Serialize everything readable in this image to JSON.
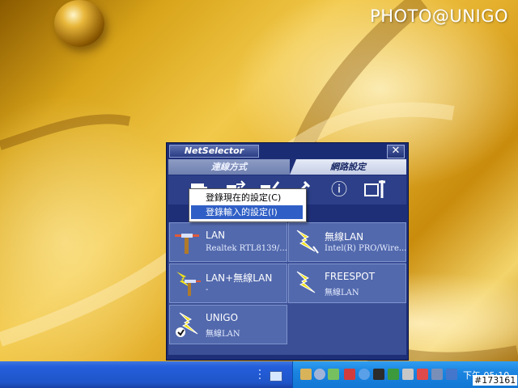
{
  "watermark": "PHOTO@UNIGO",
  "window": {
    "app_name": "NetSelector",
    "close_glyph": "✕",
    "tabs": [
      {
        "label": "連線方式",
        "active": false
      },
      {
        "label": "網路設定",
        "active": true
      }
    ],
    "toolbar_icons": [
      "register-icon",
      "transfer-icon",
      "edit-icon",
      "tools-icon",
      "info-icon",
      "settings-icon"
    ],
    "info_glyph": "ⓘ",
    "context_menu": [
      {
        "label": "登錄現在的設定(C)",
        "selected": false
      },
      {
        "label": "登錄輸入的設定(I)",
        "selected": true
      }
    ],
    "cards": [
      {
        "title": "LAN",
        "subtitle": "Realtek RTL8139/...",
        "icon": "lan-icon"
      },
      {
        "title": "無線LAN",
        "subtitle": "Intel(R) PRO/Wire...",
        "icon": "wireless-icon"
      },
      {
        "title": "LAN+無線LAN",
        "subtitle": "-",
        "icon": "lan-wireless-icon"
      },
      {
        "title": "FREESPOT",
        "subtitle": "無線LAN",
        "icon": "wireless-icon"
      },
      {
        "title": "UNIGO",
        "subtitle": "無線LAN",
        "icon": "wireless-checked-icon",
        "checked": true
      }
    ]
  },
  "taskbar": {
    "clock": "下午 05:10"
  },
  "image_id": "#173161",
  "colors": {
    "window_bg": "#1e2f78",
    "card_bg": "#5269ad",
    "taskbar": "#245edb",
    "lightning": "#f2e21a"
  }
}
